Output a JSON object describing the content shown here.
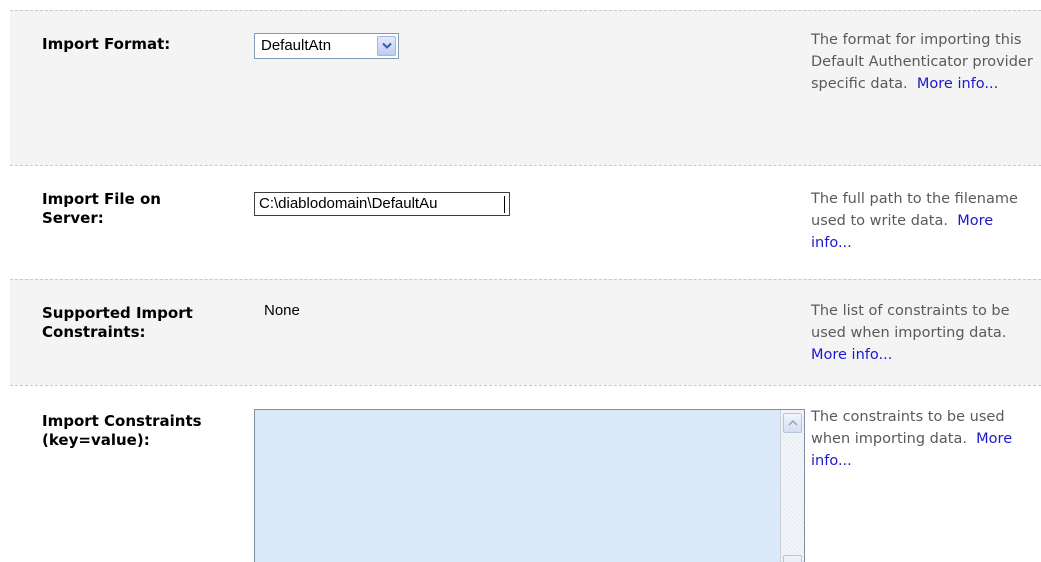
{
  "rows": [
    {
      "label": "Import Format:",
      "control": {
        "type": "select",
        "selected": "DefaultAtn"
      },
      "help": {
        "text": "The format for importing this Default Authenticator provider specific data.",
        "link": "More info..."
      }
    },
    {
      "label": "Import File on Server:",
      "control": {
        "type": "text",
        "value": "C:\\diablodomain\\DefaultAu"
      },
      "help": {
        "text": "The full path to the filename used to write data.",
        "link": "More info..."
      }
    },
    {
      "label": "Supported Import Constraints:",
      "control": {
        "type": "static",
        "value": "None"
      },
      "help": {
        "text": "The list of constraints to be used when importing data.",
        "link": "More info..."
      }
    },
    {
      "label": "Import Constraints (key=value):",
      "control": {
        "type": "textarea",
        "value": ""
      },
      "help": {
        "text": "The constraints to be used when importing data.",
        "link": "More info..."
      }
    }
  ],
  "icons": {
    "select_arrow": "chevron-down-icon",
    "scroll_up": "scroll-up-icon",
    "scroll_down": "scroll-down-icon"
  },
  "colors": {
    "shaded_row": "#f4f4f4",
    "link": "#1a1acc",
    "help_text": "#5a5a5a",
    "textarea_bg": "#dbe8f9",
    "divider": "#c9c9c9"
  }
}
